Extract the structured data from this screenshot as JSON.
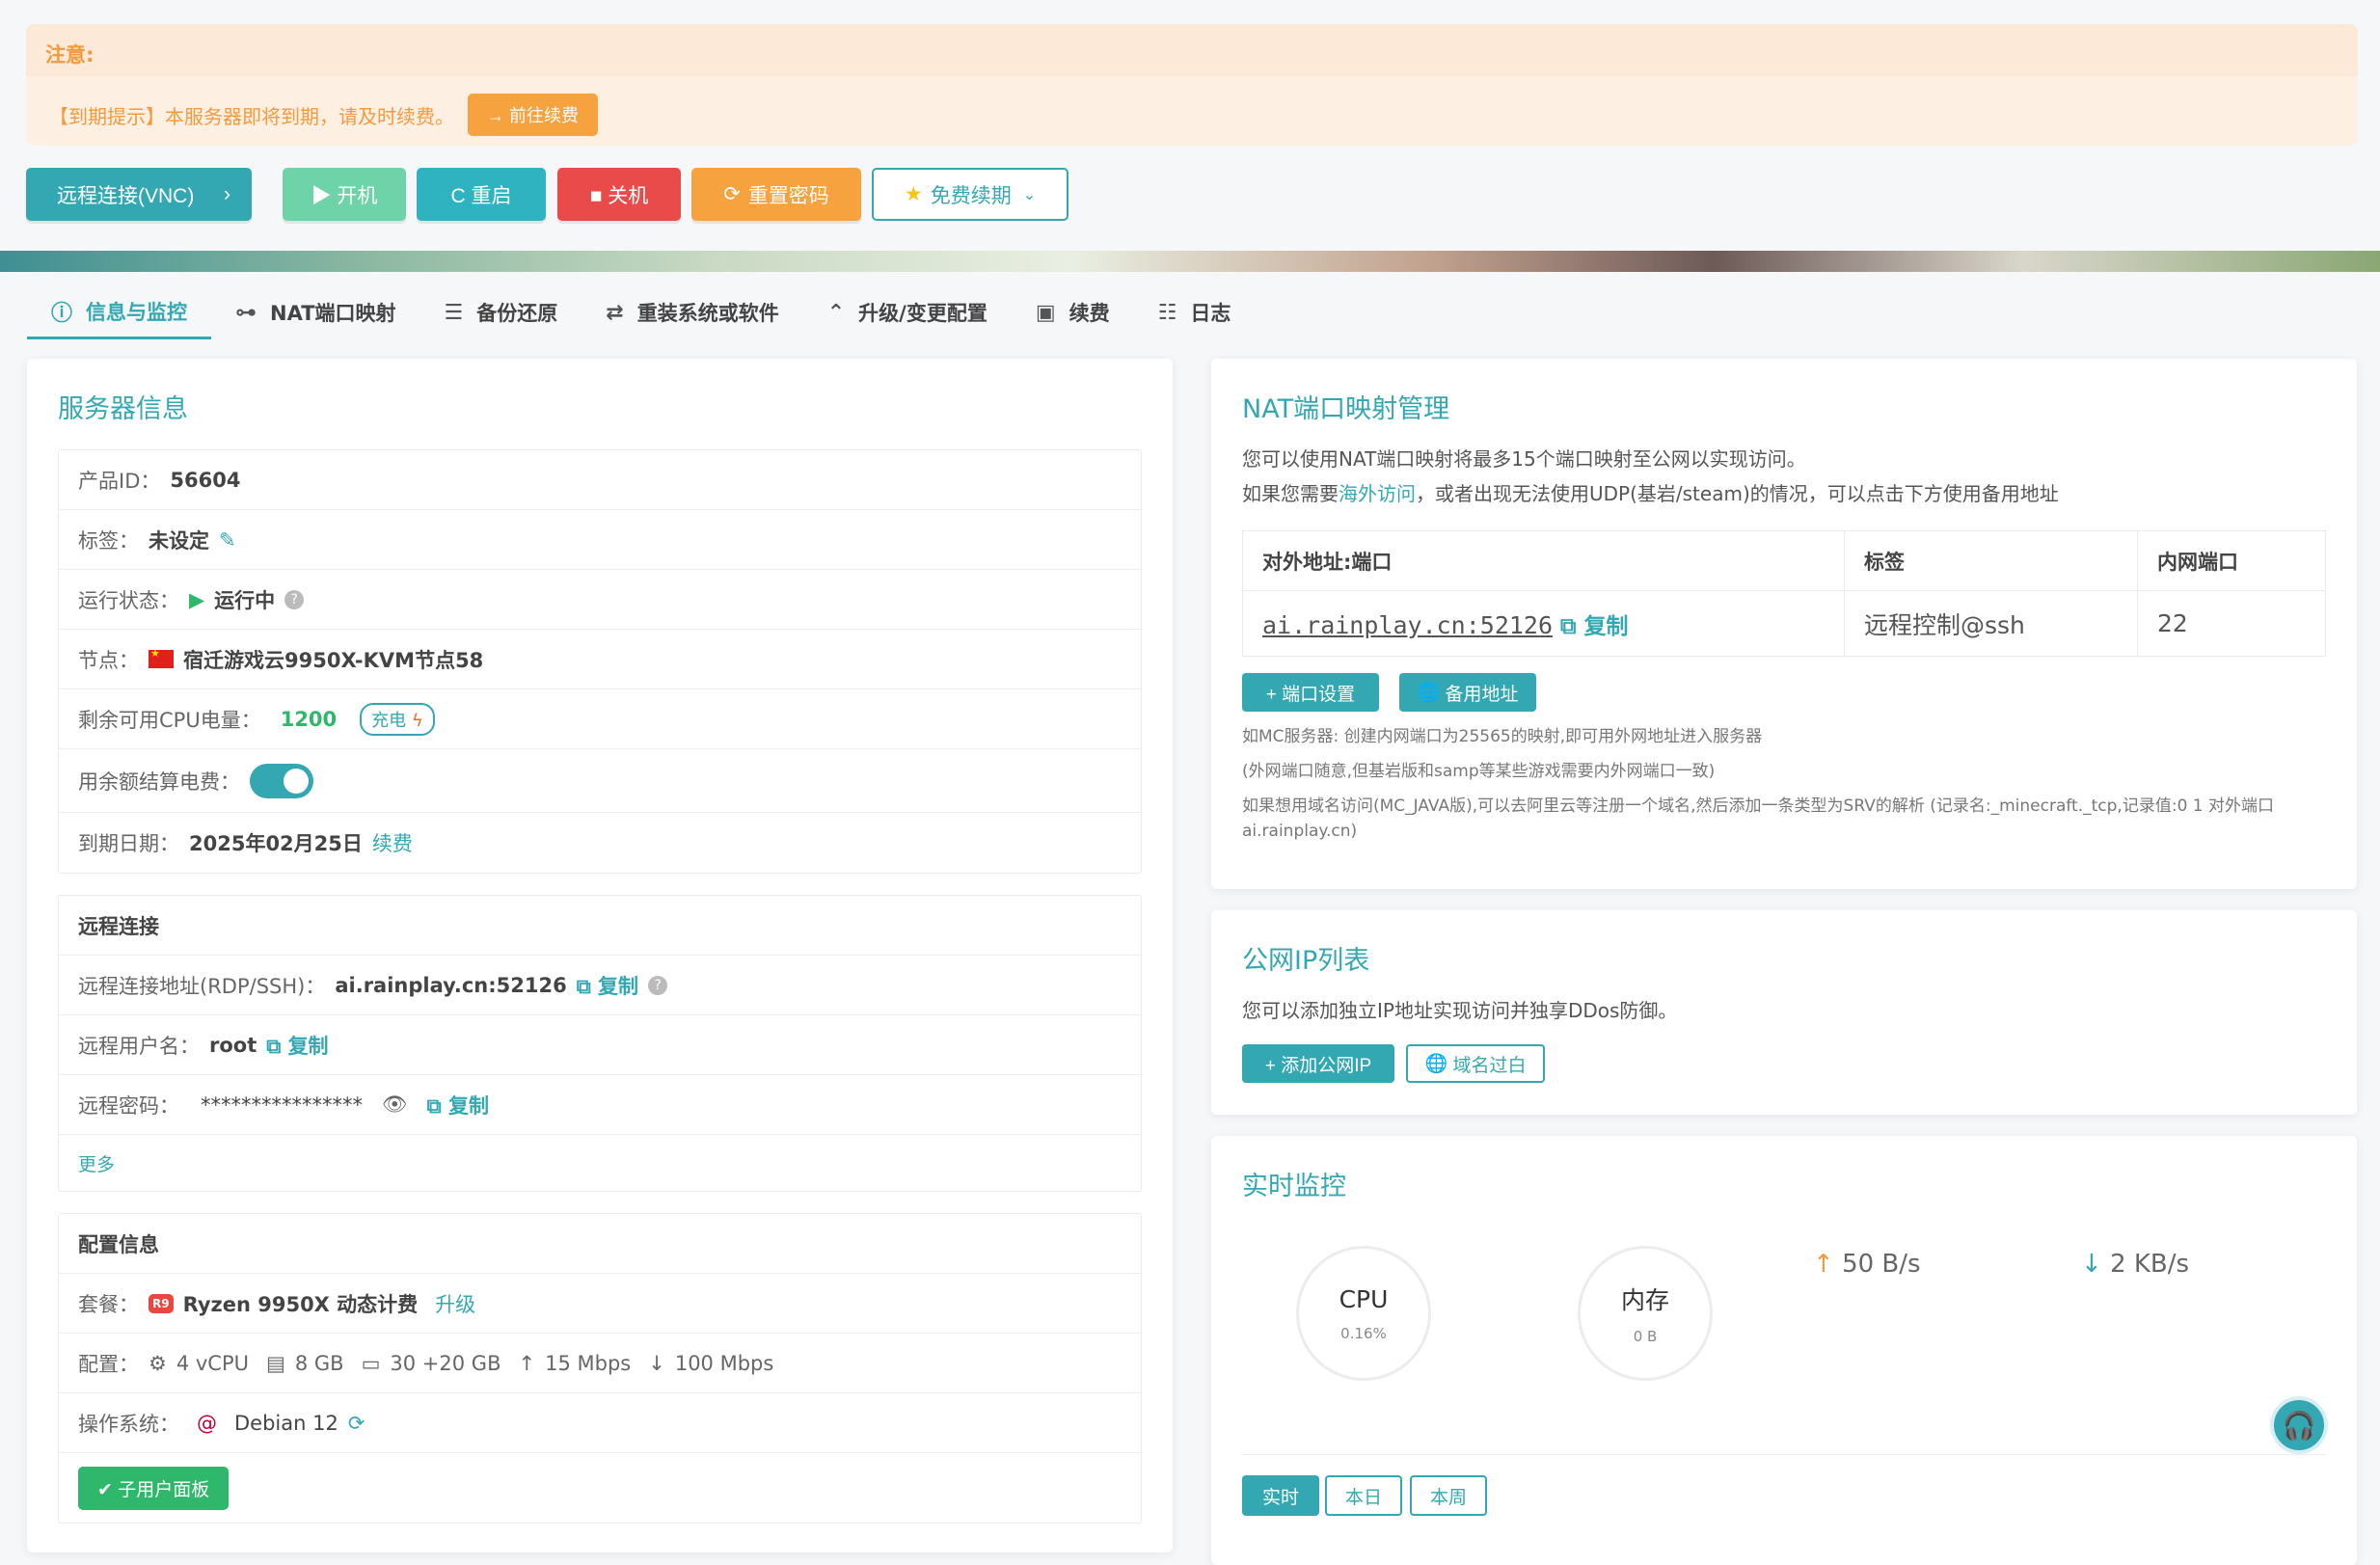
{
  "notice": {
    "heading": "注意:",
    "message": "【到期提示】本服务器即将到期，请及时续费。",
    "renew_btn": "→ 前往续费"
  },
  "actions": {
    "vnc": "远程连接(VNC)",
    "start": "▶ 开机",
    "restart": "C 重启",
    "shutdown": "■ 关机",
    "reset_password": "重置密码",
    "free_renew": "免费续期"
  },
  "tabs": [
    {
      "label": "信息与监控",
      "icon": "info-icon"
    },
    {
      "label": "NAT端口映射",
      "icon": "network-icon"
    },
    {
      "label": "备份还原",
      "icon": "drive-icon"
    },
    {
      "label": "重装系统或软件",
      "icon": "swap-icon"
    },
    {
      "label": "升级/变更配置",
      "icon": "upgrade-icon"
    },
    {
      "label": "续费",
      "icon": "money-icon"
    },
    {
      "label": "日志",
      "icon": "list-icon"
    }
  ],
  "server_info": {
    "title": "服务器信息",
    "product_id_label": "产品ID：",
    "product_id": "56604",
    "tag_label": "标签：",
    "tag": "未设定",
    "status_label": "运行状态：",
    "status": "运行中",
    "node_label": "节点：",
    "node": "宿迁游戏云9950X-KVM节点58",
    "cpu_power_label": "剩余可用CPU电量：",
    "cpu_power": "1200",
    "charge": "充电",
    "balance_label": "用余额结算电费：",
    "expire_label": "到期日期：",
    "expire": "2025年02月25日",
    "renew_link": "续费"
  },
  "remote": {
    "title": "远程连接",
    "addr_label": "远程连接地址(RDP/SSH)：",
    "addr": "ai.rainplay.cn:52126",
    "user_label": "远程用户名：",
    "user": "root",
    "pass_label": "远程密码：",
    "pass": "****************",
    "copy": "复制",
    "more": "更多"
  },
  "config": {
    "title": "配置信息",
    "plan_label": "套餐：",
    "plan_badge": "R9",
    "plan": "Ryzen 9950X 动态计费",
    "upgrade": "升级",
    "spec_label": "配置：",
    "cpu": "4 vCPU",
    "ram": "8 GB",
    "disk": "30 +20 GB",
    "up": "15 Mbps",
    "down": "100 Mbps",
    "os_label": "操作系统：",
    "os": "Debian 12",
    "sub_panel": "子用户面板"
  },
  "nat": {
    "title": "NAT端口映射管理",
    "desc1": "您可以使用NAT端口映射将最多15个端口映射至公网以实现访问。",
    "desc2_a": "如果您需要",
    "desc2_link": "海外访问",
    "desc2_b": "，或者出现无法使用UDP(基岩/steam)的情况，可以点击下方使用备用地址",
    "headers": [
      "对外地址:端口",
      "标签",
      "内网端口"
    ],
    "row": {
      "addr": "ai.rainplay.cn:52126",
      "copy": "复制",
      "tag": "远程控制@ssh",
      "port": "22"
    },
    "port_btn": "+ 端口设置",
    "backup_btn": "备用地址",
    "note1": "如MC服务器: 创建内网端口为25565的映射,即可用外网地址进入服务器",
    "note2": "(外网端口随意,但基岩版和samp等某些游戏需要内外网端口一致)",
    "note3": "如果想用域名访问(MC_JAVA版),可以去阿里云等注册一个域名,然后添加一条类型为SRV的解析 (记录名:_minecraft._tcp,记录值:0 1 对外端口 ai.rainplay.cn)"
  },
  "public_ip": {
    "title": "公网IP列表",
    "desc": "您可以添加独立IP地址实现访问并独享DDos防御。",
    "add_btn": "+ 添加公网IP",
    "whitelist_btn": "域名过白"
  },
  "monitor": {
    "title": "实时监控",
    "cpu_label": "CPU",
    "cpu_val": "0.16%",
    "mem_label": "内存",
    "mem_val": "0 B",
    "up": "50 B/s",
    "down": "2 KB/s",
    "ranges": [
      "实时",
      "本日",
      "本周"
    ]
  },
  "colors": {
    "accent": "#33a8b3",
    "warning": "#f6a23f",
    "danger": "#e94a4a",
    "success": "#5ccfa0"
  }
}
